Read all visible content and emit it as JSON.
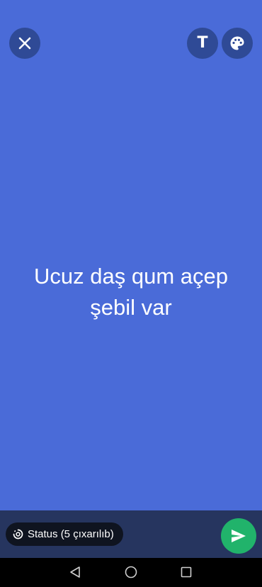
{
  "status": {
    "text": "Ucuz daş qum açep şebil var",
    "background_color": "#4a6bd8"
  },
  "toolbar": {
    "close_icon": "close-icon",
    "text_tool_label": "T",
    "palette_icon": "palette-icon"
  },
  "composer": {
    "audience_label": "Status (5 çıxarılıb)",
    "audience_icon": "status-ring-icon",
    "send_icon": "send-icon",
    "send_color": "#21b36b"
  },
  "navigation": {
    "back_icon": "nav-back-icon",
    "home_icon": "nav-home-icon",
    "recents_icon": "nav-recents-icon"
  }
}
